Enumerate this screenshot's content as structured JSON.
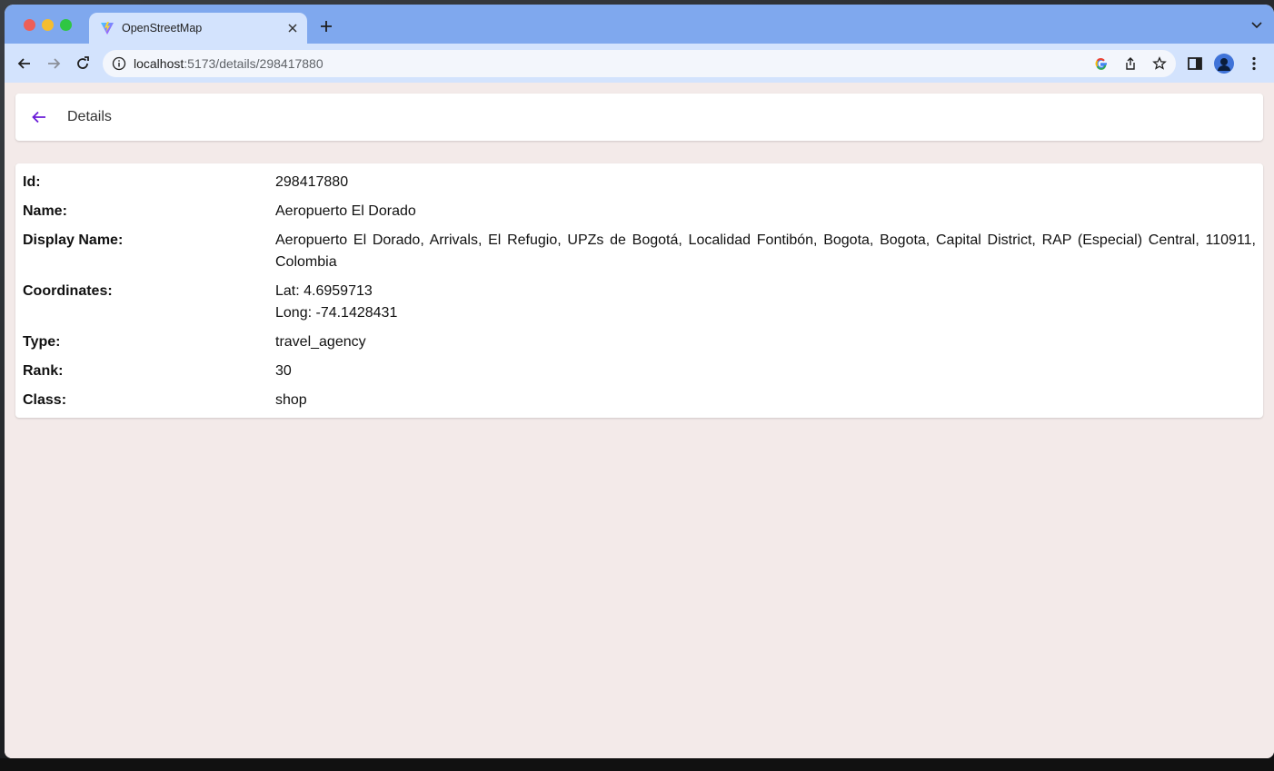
{
  "browser": {
    "tab_title": "OpenStreetMap",
    "url_host": "localhost",
    "url_path": ":5173/details/298417880"
  },
  "icons": {
    "back": "arrow-left-icon",
    "forward": "arrow-right-icon",
    "reload": "reload-icon",
    "info": "info-icon",
    "google": "google-icon",
    "share": "share-icon",
    "star": "star-icon",
    "sidepanel": "side-panel-icon",
    "profile": "profile-icon",
    "menu": "kebab-menu-icon"
  },
  "appbar": {
    "title": "Details"
  },
  "details": {
    "id_label": "Id:",
    "id_value": "298417880",
    "name_label": "Name:",
    "name_value": "Aeropuerto El Dorado",
    "display_name_label": "Display Name:",
    "display_name_value": "Aeropuerto El Dorado, Arrivals, El Refugio, UPZs de Bogotá, Localidad Fontibón, Bogota, Bogota, Capital District, RAP (Especial) Central, 110911, Colombia",
    "coordinates_label": "Coordinates:",
    "lat_value": "Lat: 4.6959713",
    "long_value": "Long: -74.1428431",
    "type_label": "Type:",
    "type_value": "travel_agency",
    "rank_label": "Rank:",
    "rank_value": "30",
    "class_label": "Class:",
    "class_value": "shop"
  },
  "colors": {
    "accent": "#6a1bd8",
    "page_bg": "#f3eae9",
    "tabstrip": "#7fa8ee",
    "toolbar": "#d3e3fd"
  }
}
